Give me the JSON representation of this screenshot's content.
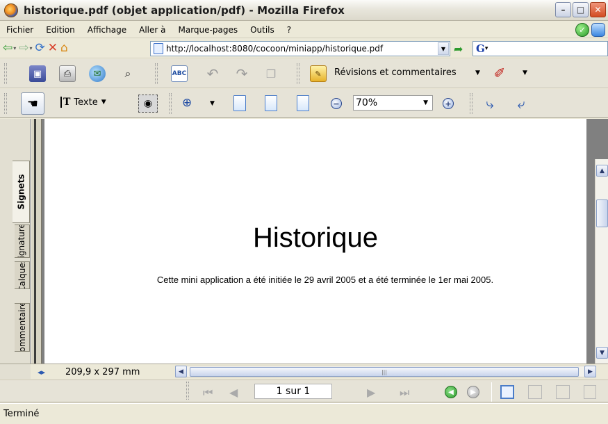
{
  "window": {
    "title": "historique.pdf (objet application/pdf) - Mozilla Firefox",
    "minimize": "–",
    "maximize": "□",
    "close": "✕"
  },
  "menu": {
    "items": [
      {
        "label": "Fichier"
      },
      {
        "label": "Edition"
      },
      {
        "label": "Affichage"
      },
      {
        "label": "Aller à"
      },
      {
        "label": "Marque-pages"
      },
      {
        "label": "Outils"
      },
      {
        "label": "?"
      }
    ]
  },
  "nav": {
    "url": "http://localhost:8080/cocoon/miniapp/historique.pdf",
    "search_logo": "G"
  },
  "acrobat": {
    "review_label": "Révisions et commentaires",
    "select_text_label": "Texte",
    "zoom_value": "70%",
    "page_size": "209,9 x 297 mm",
    "page_field": "1 sur 1"
  },
  "sidebar_tabs": [
    {
      "label": "Signets"
    },
    {
      "label": "Signatures"
    },
    {
      "label": "Calques"
    },
    {
      "label": "Commentaires"
    }
  ],
  "document": {
    "title": "Historique",
    "body": "Cette mini application a été initiée le 29 avril 2005 et a été terminée le 1er mai 2005."
  },
  "status": {
    "text": "Terminé"
  }
}
